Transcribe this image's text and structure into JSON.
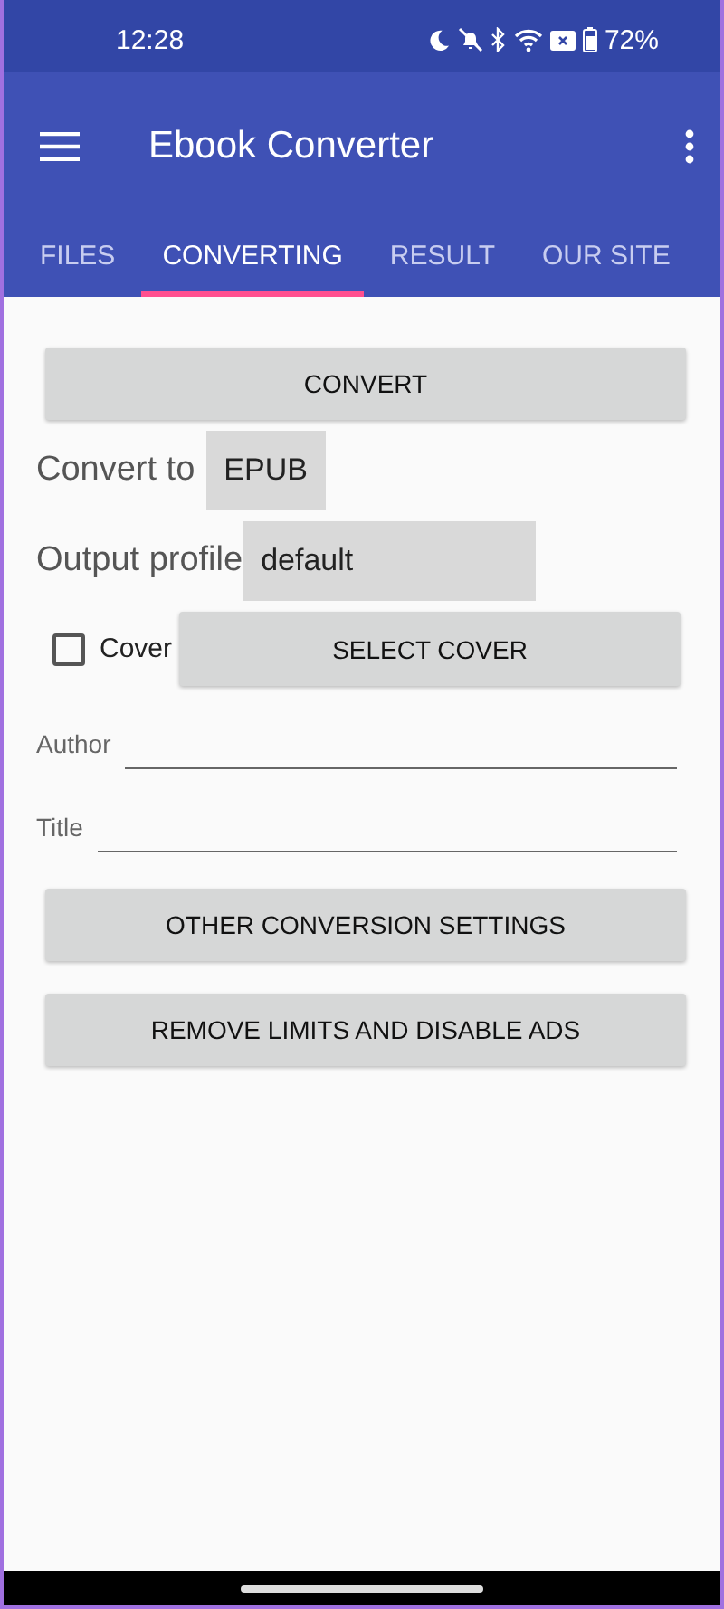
{
  "status_bar": {
    "time": "12:28",
    "battery": "72%"
  },
  "app_bar": {
    "title": "Ebook Converter"
  },
  "tabs": [
    {
      "label": "FILES",
      "selected": false
    },
    {
      "label": "CONVERTING",
      "selected": true
    },
    {
      "label": "RESULT",
      "selected": false
    },
    {
      "label": "OUR SITE",
      "selected": false
    }
  ],
  "convert_button": "CONVERT",
  "convert_to": {
    "label": "Convert to",
    "value": "EPUB"
  },
  "output_profile": {
    "label": "Output profile",
    "value": "default"
  },
  "cover": {
    "label": "Cover",
    "checked": false,
    "button": "SELECT COVER"
  },
  "fields": [
    {
      "label": "Author"
    },
    {
      "label": "Title"
    }
  ],
  "buttons": [
    "OTHER CONVERSION SETTINGS",
    "REMOVE LIMITS AND DISABLE ADS"
  ]
}
